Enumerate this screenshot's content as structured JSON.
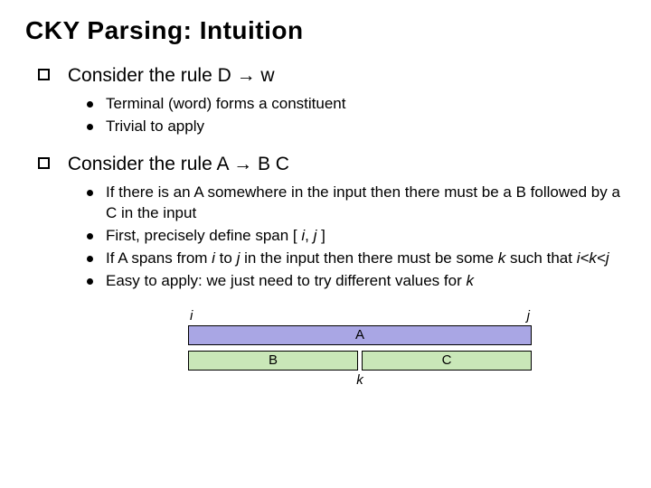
{
  "title": "CKY Parsing: Intuition",
  "item1": {
    "heading": "Consider the rule D → w",
    "subs": {
      "a": "Terminal (word) forms a constituent",
      "b": "Trivial to apply"
    }
  },
  "item2": {
    "heading": "Consider the rule A → B C",
    "subs": {
      "a": "If there is an A somewhere in the input then there must be a B followed by a C in the input",
      "b_pre": "First, precisely define span [ ",
      "b_i": "i",
      "b_mid": ", ",
      "b_j": "j",
      "b_post": " ]",
      "c_pre": "If A spans from ",
      "c_i": "i",
      "c_mid1": " to ",
      "c_j": "j",
      "c_mid2": " in the input then there must be some ",
      "c_k": "k",
      "c_mid3": " such that ",
      "c_ineq": "i<k<j",
      "d_pre": "Easy to apply: we just need to try different values for ",
      "d_k": "k"
    }
  },
  "diagram": {
    "i": "i",
    "j": "j",
    "A": "A",
    "B": "B",
    "C": "C",
    "k": "k"
  }
}
